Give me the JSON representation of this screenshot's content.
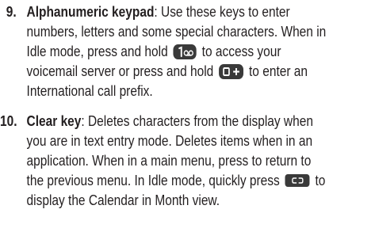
{
  "items": [
    {
      "number": "9.",
      "term": "Alphanumeric keypad",
      "lines": [
        ": Use these keys to enter",
        "numbers, letters and some special characters. When in",
        "Idle mode, press and hold",
        "to access your",
        "voicemail server or press and hold",
        "to enter an",
        "International call prefix."
      ],
      "icons": [
        "key-1-voicemail-icon",
        "key-0-plus-icon"
      ]
    },
    {
      "number": "10.",
      "term": "Clear key",
      "lines": [
        ": Deletes characters from the display when",
        "you are in text entry mode. Deletes items when in an",
        "application. When in a main menu, press to return to",
        "the previous menu. In Idle mode, quickly press",
        "to",
        "display the Calendar in Month view."
      ],
      "icons": [
        "clear-key-icon"
      ]
    }
  ],
  "colors": {
    "text": "#231f20",
    "key_fill": "#3a3a3a",
    "key_glyph": "#ffffff"
  }
}
